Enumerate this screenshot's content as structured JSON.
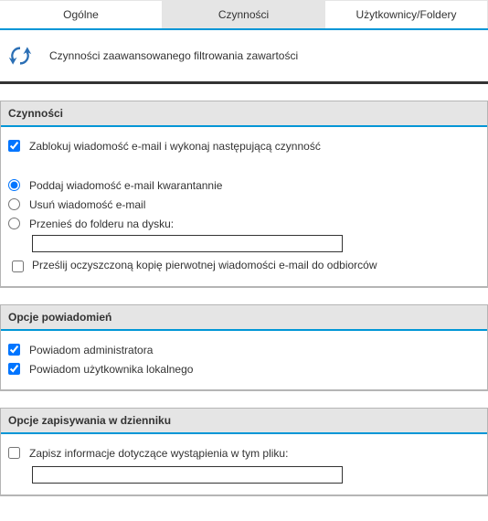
{
  "tabs": {
    "general": "Ogólne",
    "actions": "Czynności",
    "users": "Użytkownicy/Foldery"
  },
  "header": {
    "title": "Czynności zaawansowanego filtrowania zawartości"
  },
  "sections": {
    "actions": {
      "title": "Czynności",
      "block_label": "Zablokuj wiadomość e-mail i wykonaj następującą czynność",
      "radio": {
        "quarantine": "Poddaj wiadomość e-mail kwarantannie",
        "delete": "Usuń wiadomość e-mail",
        "move": "Przenieś do folderu na dysku:"
      },
      "move_path": "",
      "forward_label": "Prześlij oczyszczoną kopię pierwotnej wiadomości e-mail do odbiorców"
    },
    "notify": {
      "title": "Opcje powiadomień",
      "admin": "Powiadom administratora",
      "local_user": "Powiadom użytkownika lokalnego"
    },
    "logging": {
      "title": "Opcje zapisywania w dzienniku",
      "save_label": "Zapisz informacje dotyczące wystąpienia w tym pliku:",
      "file_path": ""
    }
  }
}
